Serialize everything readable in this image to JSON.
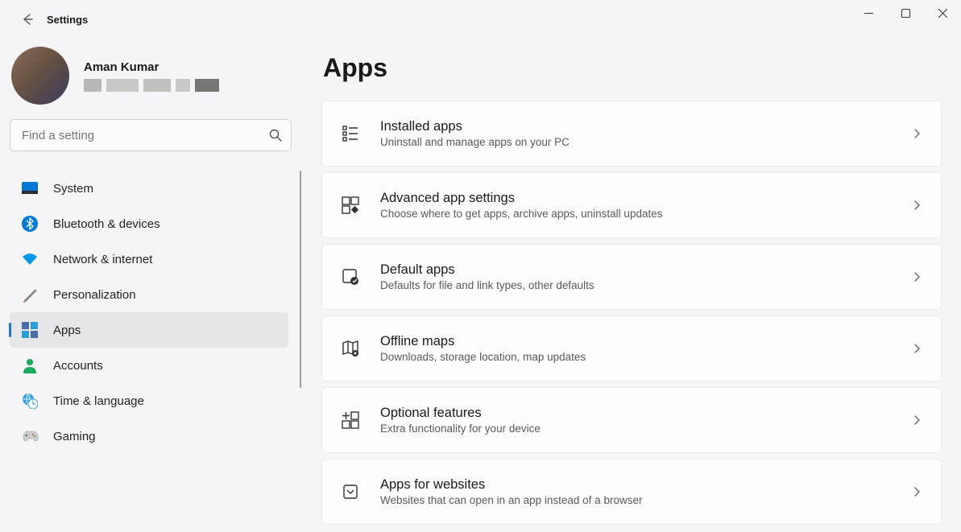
{
  "appTitle": "Settings",
  "profile": {
    "name": "Aman Kumar"
  },
  "search": {
    "placeholder": "Find a setting"
  },
  "nav": {
    "items": [
      {
        "label": "System"
      },
      {
        "label": "Bluetooth & devices"
      },
      {
        "label": "Network & internet"
      },
      {
        "label": "Personalization"
      },
      {
        "label": "Apps"
      },
      {
        "label": "Accounts"
      },
      {
        "label": "Time & language"
      },
      {
        "label": "Gaming"
      }
    ],
    "selectedIndex": 4
  },
  "page": {
    "heading": "Apps",
    "cards": [
      {
        "title": "Installed apps",
        "desc": "Uninstall and manage apps on your PC"
      },
      {
        "title": "Advanced app settings",
        "desc": "Choose where to get apps, archive apps, uninstall updates"
      },
      {
        "title": "Default apps",
        "desc": "Defaults for file and link types, other defaults"
      },
      {
        "title": "Offline maps",
        "desc": "Downloads, storage location, map updates"
      },
      {
        "title": "Optional features",
        "desc": "Extra functionality for your device"
      },
      {
        "title": "Apps for websites",
        "desc": "Websites that can open in an app instead of a browser"
      }
    ]
  }
}
